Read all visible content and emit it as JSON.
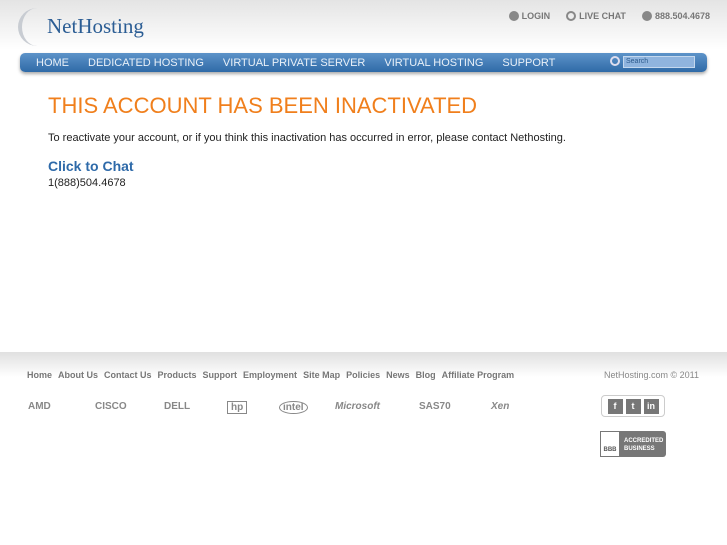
{
  "header": {
    "logo": "NetHosting",
    "login": "LOGIN",
    "live_chat": "LIVE CHAT",
    "phone": "888.504.4678"
  },
  "nav": {
    "items": [
      "HOME",
      "DEDICATED HOSTING",
      "VIRTUAL PRIVATE SERVER",
      "VIRTUAL HOSTING",
      "SUPPORT"
    ],
    "search_placeholder": "Search"
  },
  "main": {
    "title": "THIS ACCOUNT HAS BEEN INACTIVATED",
    "message": "To reactivate your account, or if you think this inactivation has occurred in error, please contact Nethosting.",
    "chat_link": "Click to Chat",
    "phone": "1(888)504.4678"
  },
  "footer": {
    "links": [
      "Home",
      "About Us",
      "Contact Us",
      "Products",
      "Support",
      "Employment",
      "Site Map",
      "Policies",
      "News",
      "Blog",
      "Affiliate Program"
    ],
    "copyright": "NetHosting.com © 2011",
    "partners": [
      "AMD",
      "CISCO",
      "DELL",
      "hp",
      "intel",
      "Microsoft",
      "SAS70",
      "Xen"
    ],
    "social": [
      "f",
      "t",
      "in"
    ],
    "bbb": {
      "line1": "ACCREDITED",
      "line2": "BUSINESS",
      "mark": "BBB"
    }
  }
}
